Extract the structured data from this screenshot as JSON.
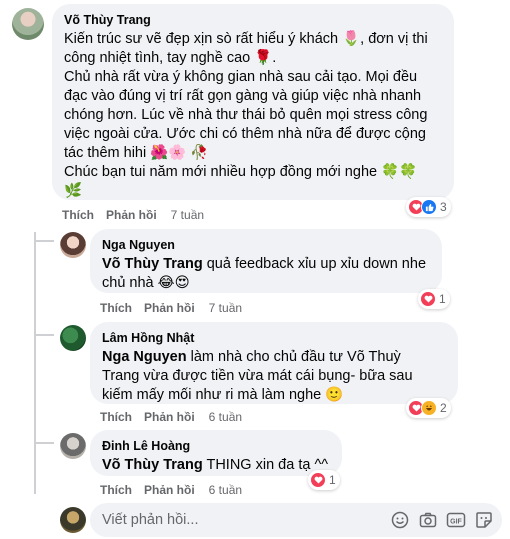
{
  "comments": [
    {
      "author": "Võ Thùy Trang",
      "lines": [
        "Kiến trúc sư vẽ đẹp xịn sò rất hiểu ý khách 🌷, đơn vị thi",
        "công nhiệt tình, tay nghề cao 🌹.",
        "Chủ nhà rất vừa ý không gian nhà sau cải tạo. Mọi đều",
        "đạc vào đúng vị trí rất gọn gàng và giúp việc nhà nhanh",
        "chóng hơn. Lúc về nhà thư thái bỏ quên mọi stress công",
        "việc ngoài cửa. Ước chi có thêm nhà nữa để được cộng",
        "tác thêm hihi 🌺🌸 🥀",
        "Chúc bạn tui năm mới nhiều hợp đồng mới nghe 🍀🍀",
        "🌿"
      ],
      "like": "Thích",
      "reply": "Phản hồi",
      "time": "7 tuần",
      "reaction_count": "3",
      "reactions": [
        "love",
        "like"
      ]
    },
    {
      "author": "Nga Nguyen",
      "mention": "Võ Thùy Trang",
      "line1_rest": " quả feedback xỉu up xỉu down nhe",
      "line2": "chủ nhà 😂😍",
      "like": "Thích",
      "reply": "Phản hồi",
      "time": "7 tuần",
      "reaction_count": "1",
      "reactions": [
        "love"
      ]
    },
    {
      "author": "Lâm Hồng Nhật",
      "mention": "Nga Nguyen",
      "line1_rest": " làm nhà cho chủ đầu tư Võ Thuỳ",
      "line2": "Trang vừa được tiền vừa mát cái bụng- bữa sau",
      "line3": "kiếm mấy mối như ri mà làm nghe 🙂",
      "like": "Thích",
      "reply": "Phản hồi",
      "time": "6 tuần",
      "reaction_count": "2",
      "reactions": [
        "love",
        "haha"
      ]
    },
    {
      "author": "Đinh Lê Hoàng",
      "mention": "Võ Thùy Trang",
      "line1_rest": " THING xin đa tạ ^^",
      "like": "Thích",
      "reply": "Phản hồi",
      "time": "6 tuần",
      "reaction_count": "1",
      "reactions": [
        "love"
      ]
    }
  ],
  "composer": {
    "placeholder": "Viết phản hồi...",
    "tools": [
      "emoji-icon",
      "camera-icon",
      "gif-icon",
      "sticker-icon"
    ]
  },
  "colors": {
    "bubble": "#f0f2f5",
    "love": "#f33e58",
    "like": "#1877f2",
    "haha": "#f7b125",
    "muted": "#65676b"
  }
}
